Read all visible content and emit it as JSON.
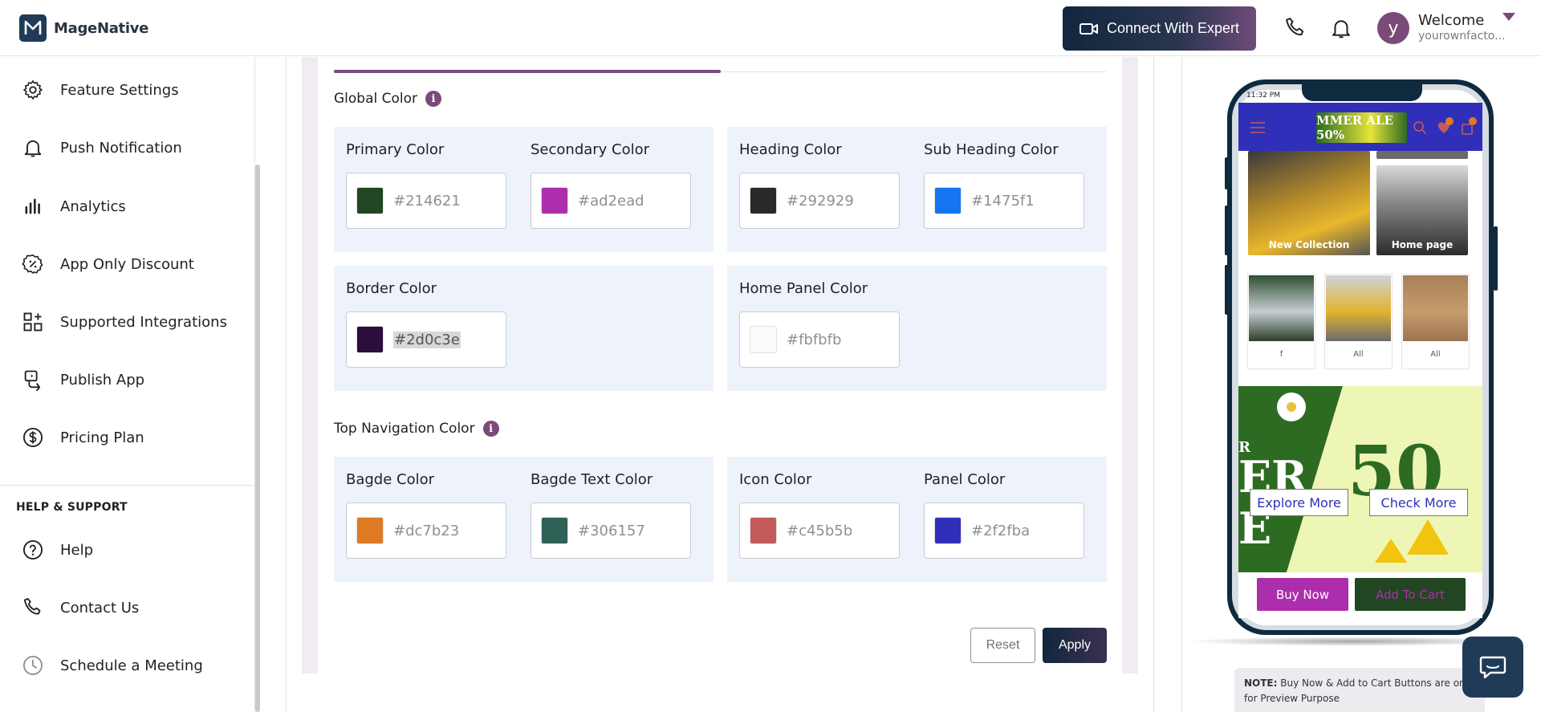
{
  "header": {
    "brand": "MageNative",
    "expert_button": "Connect With Expert",
    "welcome": "Welcome",
    "store": "yourownfacto..."
  },
  "avatar_letter": "y",
  "sidebar": {
    "items": [
      {
        "label": "Feature Settings",
        "icon": "gear-icon"
      },
      {
        "label": "Push Notification",
        "icon": "bell-icon"
      },
      {
        "label": "Analytics",
        "icon": "bar-chart-icon"
      },
      {
        "label": "App Only Discount",
        "icon": "discount-icon"
      },
      {
        "label": "Supported Integrations",
        "icon": "integrations-icon"
      },
      {
        "label": "Publish App",
        "icon": "publish-icon"
      },
      {
        "label": "Pricing Plan",
        "icon": "dollar-icon"
      }
    ],
    "support_title": "HELP & SUPPORT",
    "support_items": [
      {
        "label": "Help",
        "icon": "question-icon"
      },
      {
        "label": "Contact Us",
        "icon": "phone-icon"
      },
      {
        "label": "Schedule a Meeting",
        "icon": "clock-icon"
      }
    ]
  },
  "global_color": {
    "title": "Global Color",
    "primary": {
      "label": "Primary Color",
      "value": "#214621"
    },
    "secondary": {
      "label": "Secondary Color",
      "value": "#ad2ead"
    },
    "heading": {
      "label": "Heading Color",
      "value": "#292929"
    },
    "subheading": {
      "label": "Sub Heading Color",
      "value": "#1475f1"
    },
    "border": {
      "label": "Border Color",
      "value": "#2d0c3e"
    },
    "home_panel": {
      "label": "Home Panel Color",
      "value": "#fbfbfb"
    }
  },
  "top_nav": {
    "title": "Top Navigation Color",
    "badge": {
      "label": "Bagde Color",
      "value": "#dc7b23"
    },
    "badge_text": {
      "label": "Bagde Text Color",
      "value": "#306157"
    },
    "icon": {
      "label": "Icon Color",
      "value": "#c45b5b"
    },
    "panel": {
      "label": "Panel Color",
      "value": "#2f2fba"
    }
  },
  "actions": {
    "reset": "Reset",
    "apply": "Apply"
  },
  "preview": {
    "time": "11:32 PM",
    "banner_text": "MMER ALE 50%",
    "tile_1": "New Collection",
    "tile_2": "Home page",
    "small_1": "f",
    "small_2": "All",
    "small_3": "All",
    "explore": "Explore More",
    "check": "Check More",
    "buy_now": "Buy Now",
    "add_to_cart": "Add To Cart",
    "note_label": "NOTE:",
    "note_text": "Buy Now & Add to Cart Buttons are only for Preview Purpose"
  }
}
